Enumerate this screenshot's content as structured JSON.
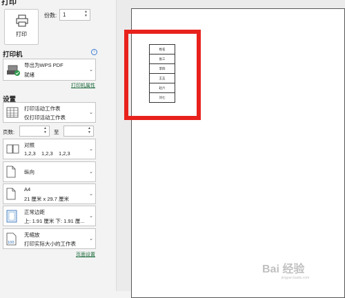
{
  "header": {
    "title_fragment": "打印"
  },
  "print_button": {
    "label": "打印"
  },
  "copies": {
    "label": "份数:",
    "value": "1"
  },
  "printer_section": {
    "title": "打印机",
    "printer_name": "导出为WPS PDF",
    "printer_status": "就绪",
    "properties_link": "打印机属性"
  },
  "settings_section": {
    "title": "设置",
    "scope": {
      "line1": "打印活动工作表",
      "line2": "仅打印活动工作表"
    },
    "pages": {
      "label": "页数:",
      "to_label": "至",
      "from_value": "",
      "to_value": ""
    },
    "collation": {
      "line1": "对照",
      "line2": "1,2,3    1,2,3    1,2,3"
    },
    "orientation": {
      "line1": "纵向"
    },
    "paper": {
      "line1": "A4",
      "line2": "21 厘米 x 29.7 厘米"
    },
    "margins": {
      "line1": "正常边距",
      "line2": "上: 1.91 厘米 下: 1.91 厘..."
    },
    "scaling": {
      "line1": "无缩放",
      "line2": "打印实际大小的工作表"
    },
    "page_setup_link": "页面设置"
  },
  "preview": {
    "table_cells": [
      "姓名",
      "张三",
      "李四",
      "王五",
      "赵六",
      "刘七"
    ]
  },
  "watermark": {
    "text": "Bai 经验",
    "sub": "jingyan.baidu.com"
  },
  "colors": {
    "highlight": "#e8211c",
    "link": "#1a6a3a",
    "info": "#3a7bd5"
  }
}
